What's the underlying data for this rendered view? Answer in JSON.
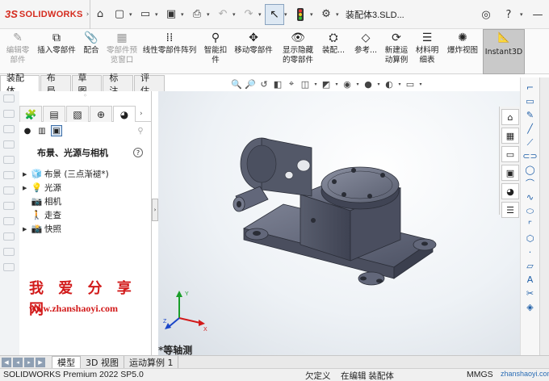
{
  "app": {
    "logo_ds": "3S",
    "logo_text": "SOLIDWORKS",
    "document_title": "装配体3.SLD..."
  },
  "toolbar": {
    "home_icon": "home-icon",
    "new_icon": "new-document-icon",
    "open_icon": "open-folder-icon",
    "save_icon": "save-icon",
    "print_icon": "print-icon",
    "undo_icon": "undo-icon",
    "redo_icon": "redo-icon",
    "select_icon": "select-arrow-icon",
    "rebuild_icon": "traffic-light-icon",
    "options_icon": "gear-icon",
    "right_icons": [
      "user-icon",
      "help-icon",
      "minimize-icon"
    ]
  },
  "commands": [
    {
      "label": "编辑零\n部件",
      "icon": "edit-component-icon",
      "disabled": true
    },
    {
      "label": "插入零部件",
      "icon": "insert-component-icon",
      "disabled": false
    },
    {
      "label": "配合",
      "icon": "mate-icon",
      "disabled": false
    },
    {
      "label": "零部件预\n览窗口",
      "icon": "preview-window-icon",
      "disabled": true
    },
    {
      "label": "线性零部件阵列",
      "icon": "linear-pattern-icon",
      "disabled": false
    },
    {
      "label": "智能扣\n件",
      "icon": "smart-fastener-icon",
      "disabled": false
    },
    {
      "label": "移动零部件",
      "icon": "move-component-icon",
      "disabled": false
    },
    {
      "label": "显示隐藏\n的零部件",
      "icon": "show-hidden-icon",
      "disabled": false
    },
    {
      "label": "装配...",
      "icon": "assembly-feature-icon",
      "disabled": false
    },
    {
      "label": "参考...",
      "icon": "reference-geometry-icon",
      "disabled": false
    },
    {
      "label": "新建运\n动算例",
      "icon": "new-motion-study-icon",
      "disabled": false
    },
    {
      "label": "材料明\n细表",
      "icon": "bom-icon",
      "disabled": false
    },
    {
      "label": "爆炸视图",
      "icon": "explode-view-icon",
      "disabled": false
    }
  ],
  "instant3d": {
    "label": "Instant3D"
  },
  "tabs": [
    "装配体",
    "布局",
    "草图",
    "标注",
    "评估"
  ],
  "active_tab": "装配体",
  "panel": {
    "title": "布景、光源与相机",
    "help": "?",
    "tree": [
      {
        "label": "布景 (三点渐褪*)",
        "icon": "scene-icon"
      },
      {
        "label": "光源",
        "icon": "light-icon"
      },
      {
        "label": "相机",
        "icon": "camera-icon"
      },
      {
        "label": "走查",
        "icon": "walkthrough-icon"
      },
      {
        "label": "快照",
        "icon": "snapshot-icon"
      }
    ]
  },
  "watermark": {
    "cn": "我 爱 分 享 网",
    "url": "www.zhanshaoyi.com",
    "corner_url": "zhanshaoyi.com"
  },
  "viewport": {
    "view_label": "*等轴测"
  },
  "bottom_tabs": [
    "模型",
    "3D 视图",
    "运动算例 1"
  ],
  "status": {
    "product": "SOLIDWORKS Premium 2022 SP5.0",
    "under_defined": "欠定义",
    "editing": "在编辑 装配体",
    "units": "MMGS"
  },
  "colors": {
    "accent": "#d52b1e",
    "part": "#5a5f70",
    "selected_tab": "#c9c9c9"
  }
}
